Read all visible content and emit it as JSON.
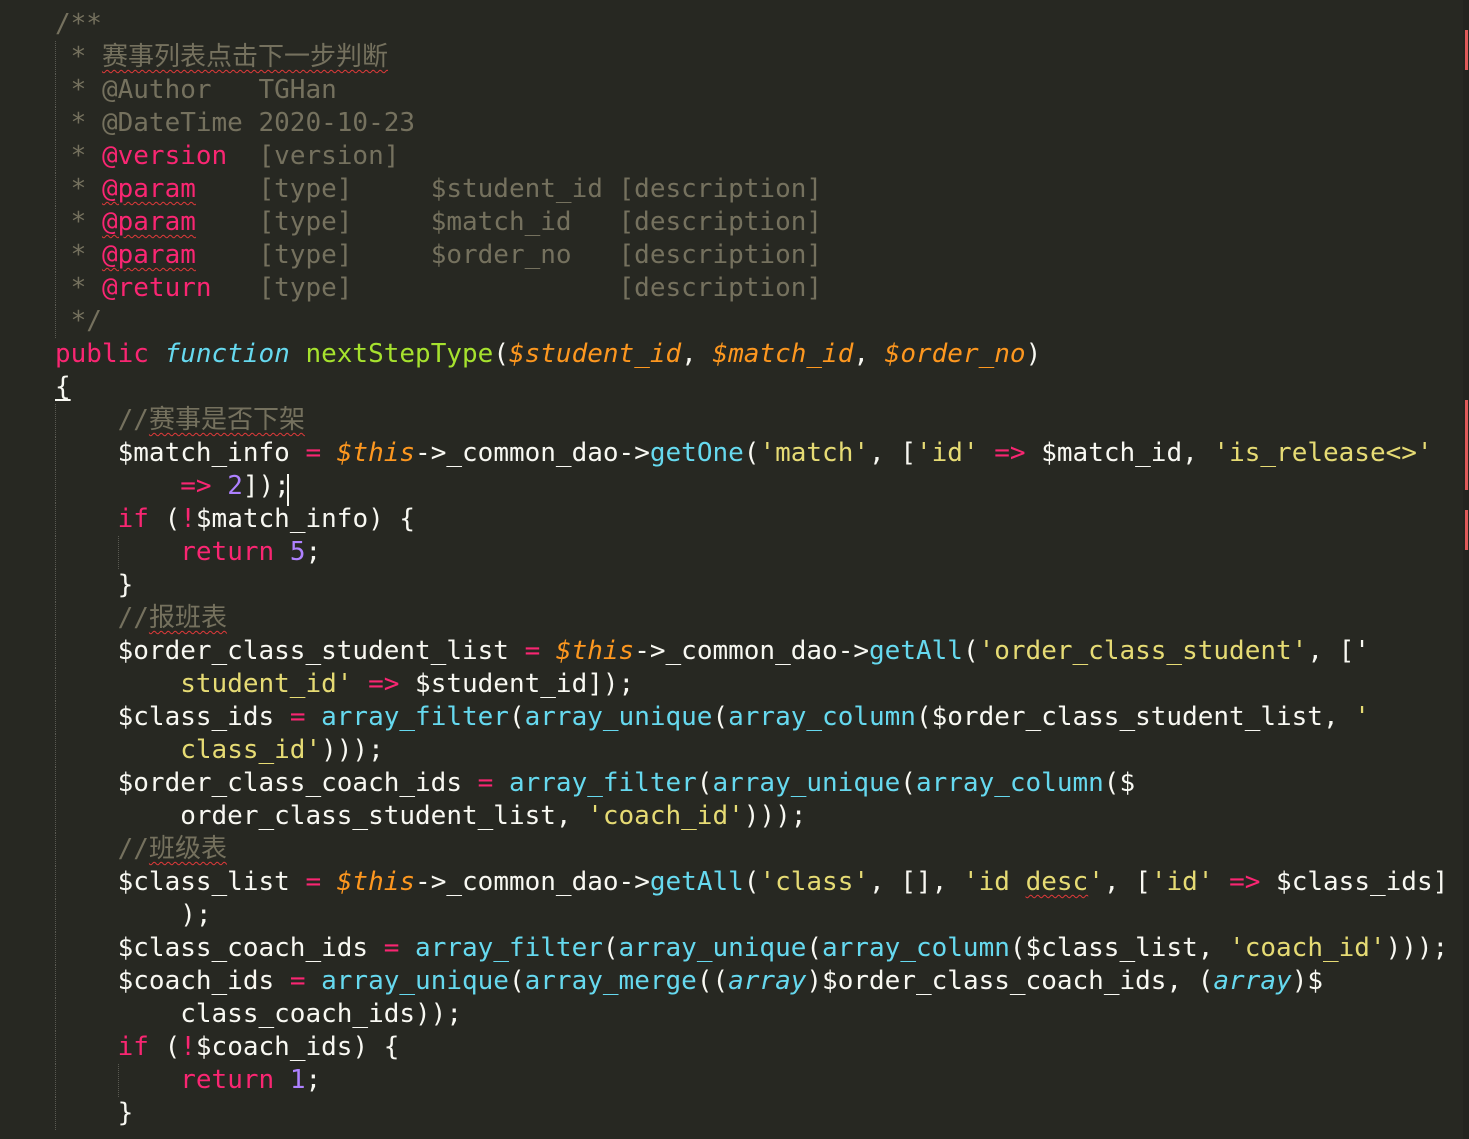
{
  "editor": {
    "theme": "monokai",
    "colors": {
      "background": "#272822",
      "foreground": "#f8f8f2",
      "comment": "#75715e",
      "keyword": "#f92672",
      "storage": "#66d9ef",
      "function_name": "#a6e22e",
      "parameter": "#fd971f",
      "string": "#e6db74",
      "number": "#ae81ff"
    },
    "lines": [
      [
        {
          "t": "/**",
          "c": "comment"
        }
      ],
      [
        {
          "t": " * ",
          "c": "comment"
        },
        {
          "t": "赛事列表点击下一步判断",
          "c": "comment",
          "spell": true
        }
      ],
      [
        {
          "t": " * @Author   TGHan",
          "c": "comment"
        }
      ],
      [
        {
          "t": " * @DateTime 2020-10-23",
          "c": "comment"
        }
      ],
      [
        {
          "t": " * ",
          "c": "comment"
        },
        {
          "t": "@version",
          "c": "tag"
        },
        {
          "t": "  [version]",
          "c": "comment"
        }
      ],
      [
        {
          "t": " * ",
          "c": "comment"
        },
        {
          "t": "@param",
          "c": "tag",
          "spell": true
        },
        {
          "t": "    [type]     $student_id [description]",
          "c": "comment"
        }
      ],
      [
        {
          "t": " * ",
          "c": "comment"
        },
        {
          "t": "@param",
          "c": "tag",
          "spell": true
        },
        {
          "t": "    [type]     $match_id   [description]",
          "c": "comment"
        }
      ],
      [
        {
          "t": " * ",
          "c": "comment"
        },
        {
          "t": "@param",
          "c": "tag",
          "spell": true
        },
        {
          "t": "    [type]     $order_no   [description]",
          "c": "comment"
        }
      ],
      [
        {
          "t": " * ",
          "c": "comment"
        },
        {
          "t": "@return",
          "c": "tag"
        },
        {
          "t": "   [type]                 [description]",
          "c": "comment"
        }
      ],
      [
        {
          "t": " */",
          "c": "comment"
        }
      ],
      [
        {
          "t": "public",
          "c": "kw"
        },
        {
          "t": " ",
          "c": "var"
        },
        {
          "t": "function",
          "c": "storage"
        },
        {
          "t": " ",
          "c": "var"
        },
        {
          "t": "nextStepType",
          "c": "func"
        },
        {
          "t": "(",
          "c": "punc"
        },
        {
          "t": "$student_id",
          "c": "param"
        },
        {
          "t": ", ",
          "c": "punc"
        },
        {
          "t": "$match_id",
          "c": "param"
        },
        {
          "t": ", ",
          "c": "punc"
        },
        {
          "t": "$order_no",
          "c": "param"
        },
        {
          "t": ")",
          "c": "punc"
        }
      ],
      [
        {
          "t": "{",
          "c": "punc",
          "brace": true
        }
      ],
      [
        {
          "t": "    ",
          "c": "var"
        },
        {
          "t": "//",
          "c": "comment"
        },
        {
          "t": "赛事是否下架",
          "c": "comment",
          "spell": true
        }
      ],
      [
        {
          "t": "    $match_info ",
          "c": "var"
        },
        {
          "t": "=",
          "c": "op"
        },
        {
          "t": " ",
          "c": "var"
        },
        {
          "t": "$this",
          "c": "this"
        },
        {
          "t": "->_common_dao->",
          "c": "var"
        },
        {
          "t": "getOne",
          "c": "call"
        },
        {
          "t": "(",
          "c": "punc"
        },
        {
          "t": "'match'",
          "c": "str"
        },
        {
          "t": ", [",
          "c": "punc"
        },
        {
          "t": "'id'",
          "c": "str"
        },
        {
          "t": " ",
          "c": "var"
        },
        {
          "t": "=>",
          "c": "op"
        },
        {
          "t": " $match_id, ",
          "c": "var"
        },
        {
          "t": "'is_release<>'",
          "c": "str"
        }
      ],
      [
        {
          "t": "        ",
          "c": "var"
        },
        {
          "t": "=>",
          "c": "op"
        },
        {
          "t": " ",
          "c": "var"
        },
        {
          "t": "2",
          "c": "num"
        },
        {
          "t": "]);",
          "c": "punc"
        }
      ],
      [
        {
          "t": "    ",
          "c": "var"
        },
        {
          "t": "if",
          "c": "kw"
        },
        {
          "t": " (",
          "c": "punc"
        },
        {
          "t": "!",
          "c": "op"
        },
        {
          "t": "$match_info) {",
          "c": "var"
        }
      ],
      [
        {
          "t": "        ",
          "c": "var"
        },
        {
          "t": "return",
          "c": "kw"
        },
        {
          "t": " ",
          "c": "var"
        },
        {
          "t": "5",
          "c": "num"
        },
        {
          "t": ";",
          "c": "punc"
        }
      ],
      [
        {
          "t": "    }",
          "c": "punc"
        }
      ],
      [
        {
          "t": "    ",
          "c": "var"
        },
        {
          "t": "//",
          "c": "comment"
        },
        {
          "t": "报班表",
          "c": "comment",
          "spell": true
        }
      ],
      [
        {
          "t": "    $order_class_student_list ",
          "c": "var"
        },
        {
          "t": "=",
          "c": "op"
        },
        {
          "t": " ",
          "c": "var"
        },
        {
          "t": "$this",
          "c": "this"
        },
        {
          "t": "->_common_dao->",
          "c": "var"
        },
        {
          "t": "getAll",
          "c": "call"
        },
        {
          "t": "(",
          "c": "punc"
        },
        {
          "t": "'order_class_student'",
          "c": "str"
        },
        {
          "t": ", ['",
          "c": "punc"
        }
      ],
      [
        {
          "t": "        ",
          "c": "var"
        },
        {
          "t": "student_id'",
          "c": "str"
        },
        {
          "t": " ",
          "c": "var"
        },
        {
          "t": "=>",
          "c": "op"
        },
        {
          "t": " $student_id]);",
          "c": "var"
        }
      ],
      [
        {
          "t": "    $class_ids ",
          "c": "var"
        },
        {
          "t": "=",
          "c": "op"
        },
        {
          "t": " ",
          "c": "var"
        },
        {
          "t": "array_filter",
          "c": "call"
        },
        {
          "t": "(",
          "c": "punc"
        },
        {
          "t": "array_unique",
          "c": "call"
        },
        {
          "t": "(",
          "c": "punc"
        },
        {
          "t": "array_column",
          "c": "call"
        },
        {
          "t": "($order_class_student_list, ",
          "c": "var"
        },
        {
          "t": "'",
          "c": "str"
        }
      ],
      [
        {
          "t": "        ",
          "c": "var"
        },
        {
          "t": "class_id'",
          "c": "str"
        },
        {
          "t": ")));",
          "c": "punc"
        }
      ],
      [
        {
          "t": "    $order_class_coach_ids ",
          "c": "var"
        },
        {
          "t": "=",
          "c": "op"
        },
        {
          "t": " ",
          "c": "var"
        },
        {
          "t": "array_filter",
          "c": "call"
        },
        {
          "t": "(",
          "c": "punc"
        },
        {
          "t": "array_unique",
          "c": "call"
        },
        {
          "t": "(",
          "c": "punc"
        },
        {
          "t": "array_column",
          "c": "call"
        },
        {
          "t": "($",
          "c": "var"
        }
      ],
      [
        {
          "t": "        order_class_student_list, ",
          "c": "var"
        },
        {
          "t": "'coach_id'",
          "c": "str"
        },
        {
          "t": ")));",
          "c": "punc"
        }
      ],
      [
        {
          "t": "    ",
          "c": "var"
        },
        {
          "t": "//",
          "c": "comment"
        },
        {
          "t": "班级表",
          "c": "comment",
          "spell": true
        }
      ],
      [
        {
          "t": "    $class_list ",
          "c": "var"
        },
        {
          "t": "=",
          "c": "op"
        },
        {
          "t": " ",
          "c": "var"
        },
        {
          "t": "$this",
          "c": "this"
        },
        {
          "t": "->_common_dao->",
          "c": "var"
        },
        {
          "t": "getAll",
          "c": "call"
        },
        {
          "t": "(",
          "c": "punc"
        },
        {
          "t": "'class'",
          "c": "str"
        },
        {
          "t": ", [], ",
          "c": "punc"
        },
        {
          "t": "'id ",
          "c": "str"
        },
        {
          "t": "desc",
          "c": "str",
          "spell": true
        },
        {
          "t": "'",
          "c": "str"
        },
        {
          "t": ", [",
          "c": "punc"
        },
        {
          "t": "'id'",
          "c": "str"
        },
        {
          "t": " ",
          "c": "var"
        },
        {
          "t": "=>",
          "c": "op"
        },
        {
          "t": " $class_ids]",
          "c": "var"
        }
      ],
      [
        {
          "t": "        );",
          "c": "punc"
        }
      ],
      [
        {
          "t": "    $class_coach_ids ",
          "c": "var"
        },
        {
          "t": "=",
          "c": "op"
        },
        {
          "t": " ",
          "c": "var"
        },
        {
          "t": "array_filter",
          "c": "call"
        },
        {
          "t": "(",
          "c": "punc"
        },
        {
          "t": "array_unique",
          "c": "call"
        },
        {
          "t": "(",
          "c": "punc"
        },
        {
          "t": "array_column",
          "c": "call"
        },
        {
          "t": "($class_list, ",
          "c": "var"
        },
        {
          "t": "'coach_id'",
          "c": "str"
        },
        {
          "t": ")));",
          "c": "punc"
        }
      ],
      [
        {
          "t": "    $coach_ids ",
          "c": "var"
        },
        {
          "t": "=",
          "c": "op"
        },
        {
          "t": " ",
          "c": "var"
        },
        {
          "t": "array_unique",
          "c": "call"
        },
        {
          "t": "(",
          "c": "punc"
        },
        {
          "t": "array_merge",
          "c": "call"
        },
        {
          "t": "((",
          "c": "punc"
        },
        {
          "t": "array",
          "c": "cast"
        },
        {
          "t": ")$order_class_coach_ids, (",
          "c": "var"
        },
        {
          "t": "array",
          "c": "cast"
        },
        {
          "t": ")$",
          "c": "var"
        }
      ],
      [
        {
          "t": "        class_coach_ids));",
          "c": "var"
        }
      ],
      [
        {
          "t": "    ",
          "c": "var"
        },
        {
          "t": "if",
          "c": "kw"
        },
        {
          "t": " (",
          "c": "punc"
        },
        {
          "t": "!",
          "c": "op"
        },
        {
          "t": "$coach_ids) {",
          "c": "var"
        }
      ],
      [
        {
          "t": "        ",
          "c": "var"
        },
        {
          "t": "return",
          "c": "kw"
        },
        {
          "t": " ",
          "c": "var"
        },
        {
          "t": "1",
          "c": "num"
        },
        {
          "t": ";",
          "c": "punc"
        }
      ],
      [
        {
          "t": "    }",
          "c": "punc"
        }
      ]
    ]
  }
}
